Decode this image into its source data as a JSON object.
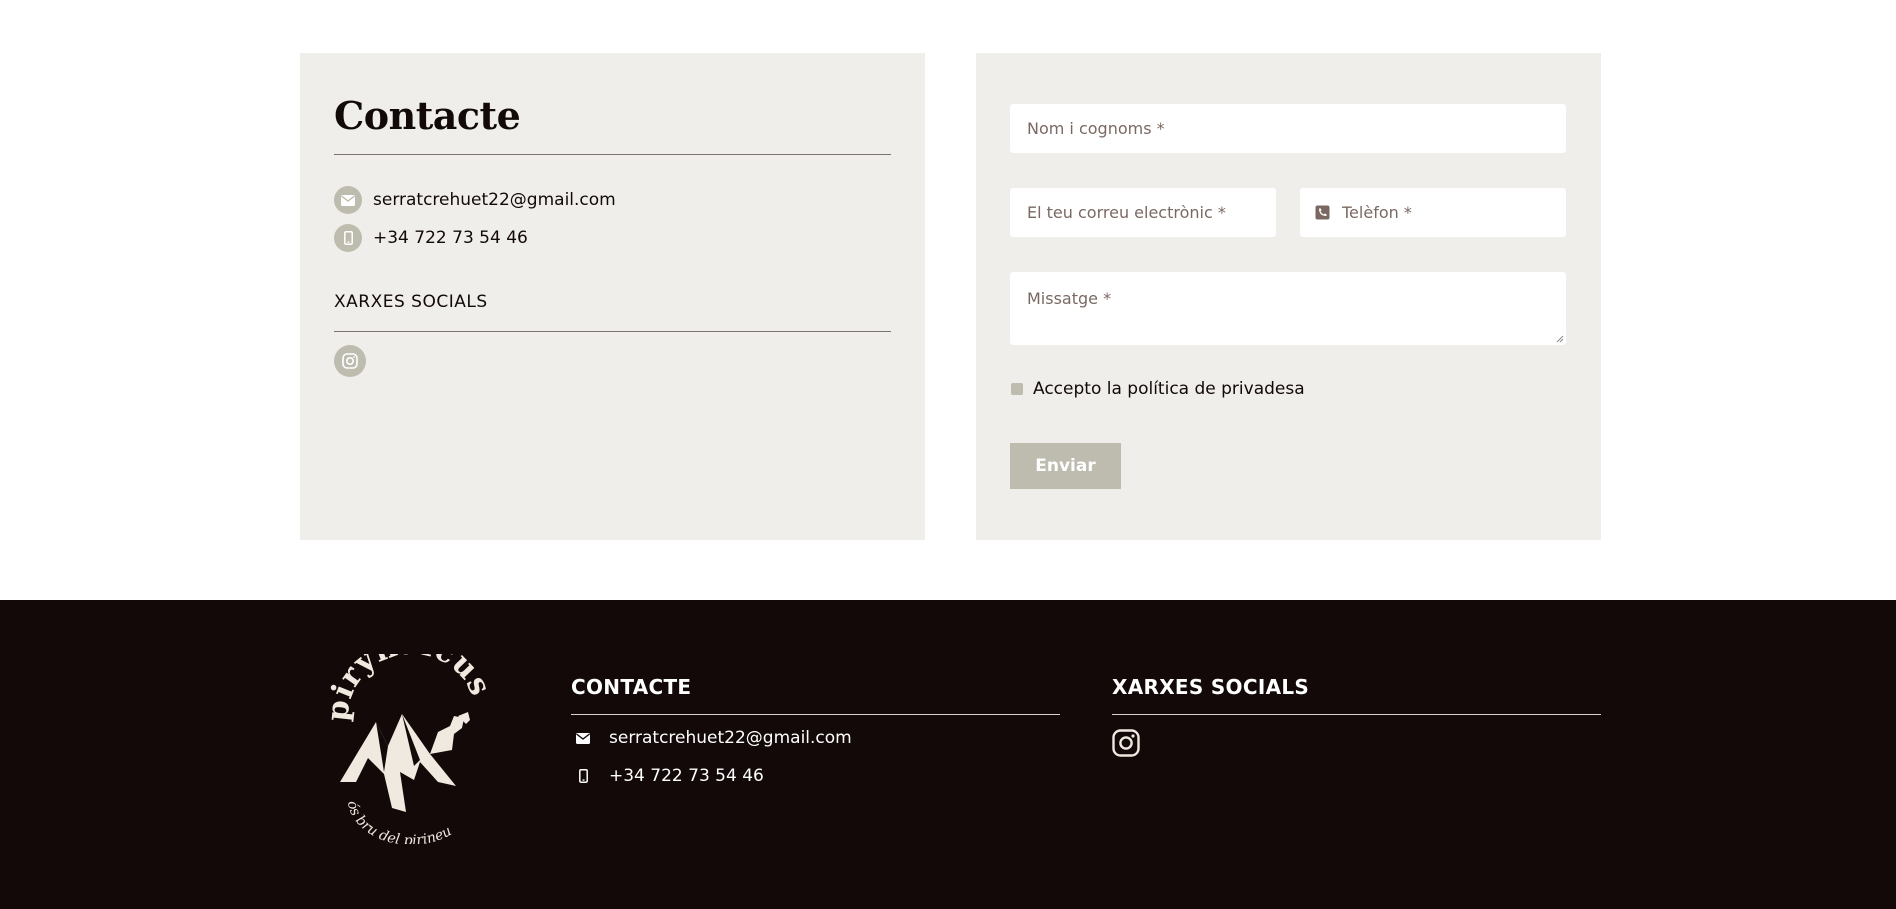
{
  "contact_panel": {
    "title": "Contacte",
    "email": "serratcrehuet22@gmail.com",
    "phone": "+34 722 73 54 46",
    "social_title": "XARXES SOCIALS"
  },
  "form": {
    "name_placeholder": "Nom i cognoms *",
    "email_placeholder": "El teu correu electrònic *",
    "phone_placeholder": "Telèfon *",
    "message_placeholder": "Missatge *",
    "privacy_label": "Accepto la política de privadesa",
    "submit_label": "Enviar"
  },
  "footer": {
    "logo_text": "pirynaicus",
    "logo_subtitle": "ós bru del pirineu",
    "contact_title": "CONTACTE",
    "email": "serratcrehuet22@gmail.com",
    "phone": "+34 722 73 54 46",
    "social_title": "XARXES SOCIALS"
  },
  "colors": {
    "panel_bg": "#f0eeea",
    "accent": "#bdbcae",
    "footer_bg": "#120908",
    "text_dark": "#120a08"
  },
  "icons": [
    "envelope-icon",
    "mobile-phone-icon",
    "instagram-icon",
    "phone-icon"
  ]
}
